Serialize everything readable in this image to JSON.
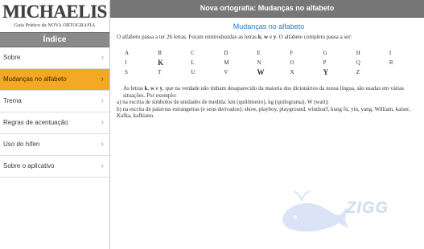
{
  "sidebar": {
    "logo": "MICHAELIS",
    "logo_sub": "Guia Prático da NOVA ORTOGRAFIA",
    "index_title": "Índice",
    "items": [
      {
        "label": "Sobre"
      },
      {
        "label": "Mudanças no alfabeto"
      },
      {
        "label": "Trema"
      },
      {
        "label": "Regras de acentuação"
      },
      {
        "label": "Uso do hífen"
      },
      {
        "label": "Sobre o aplicativo"
      }
    ],
    "active_index": 1
  },
  "header": {
    "title": "Nova ortografia: Mudanças no alfabeto"
  },
  "article": {
    "title": "Mudanças no alfabeto",
    "intro_a": "O alfabeto passa a ter 26 letras. Foram reintroduzidas as letras ",
    "intro_k": "k",
    "intro_b": ", ",
    "intro_w": "w",
    "intro_c": " e ",
    "intro_y": "y",
    "intro_d": ". O alfabeto completo passa a ser:",
    "alphabet_rows": [
      [
        "A",
        "B",
        "C",
        "D",
        "E",
        "F",
        "G",
        "H",
        "I"
      ],
      [
        "J",
        "K",
        "L",
        "M",
        "N",
        "O",
        "P",
        "Q",
        "R"
      ],
      [
        "S",
        "T",
        "U",
        "V",
        "W",
        "X",
        "Y",
        "Z",
        ""
      ]
    ],
    "bold_letters": [
      "K",
      "W",
      "Y"
    ],
    "p1_a": "As letras ",
    "p1_k": "k",
    "p1_b": ", ",
    "p1_w": "w",
    "p1_c": " e ",
    "p1_y": "y",
    "p1_d": ", que na verdade não tinham desaparecido da maioria dos dicionários da nossa língua, são usadas em várias situações. Por exemplo:",
    "item_a": "a) na escrita de símbolos de unidades de medida: km (quilômetro), kg (quilograma), W (watt);",
    "item_b": "b) na escrita de palavras estrangeiras (e seus derivados): show, playboy, playground, windsurf, kung fu, yin, yang, William, kaiser, Kafka, kafkiano."
  },
  "watermark": {
    "text": "ZIGG",
    "icon": "whale-icon"
  },
  "colors": {
    "accent": "#f3a923",
    "title_blue": "#2a7ac7",
    "bar_gray": "#777777"
  }
}
